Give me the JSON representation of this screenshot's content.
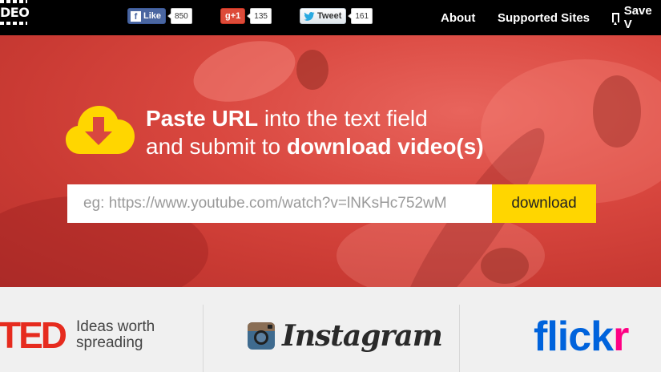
{
  "header": {
    "logo_fragment": "DEO",
    "social": {
      "facebook": {
        "label": "Like",
        "icon": "f",
        "count": "850"
      },
      "googleplus": {
        "label": "g+1",
        "count": "135"
      },
      "twitter": {
        "label": "Tweet",
        "count": "161"
      }
    },
    "nav": {
      "about": "About",
      "supported_sites": "Supported Sites",
      "save_video": "Save V"
    }
  },
  "hero": {
    "headline_part1_bold": "Paste URL",
    "headline_part1_rest": " into the text field",
    "headline_part2_rest": "and submit to ",
    "headline_part2_bold": "download video(s)",
    "url_input": {
      "value": "",
      "placeholder": "eg: https://www.youtube.com/watch?v=lNKsHc752wM"
    },
    "download_button": "download",
    "icon": "cloud-download-icon"
  },
  "sites": {
    "ted": {
      "name": "TED",
      "tagline_line1": "Ideas worth",
      "tagline_line2": "spreading"
    },
    "instagram": {
      "name": "Instagram"
    },
    "flickr": {
      "name_part1": "flick",
      "name_part2": "r"
    }
  },
  "colors": {
    "topbar": "#000000",
    "hero_red": "#d9473f",
    "accent_yellow": "#ffd600",
    "ted_red": "#e62b1e",
    "flickr_blue": "#0063dc",
    "flickr_pink": "#ff0084"
  }
}
